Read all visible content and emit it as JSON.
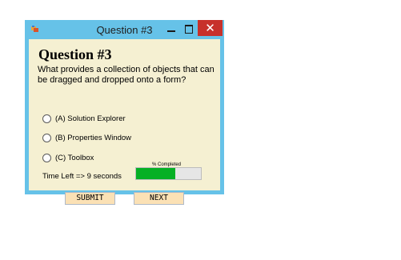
{
  "window": {
    "title": "Question #3"
  },
  "titlebar": {
    "minimize_icon": "minimize-icon",
    "maximize_icon": "maximize-icon",
    "close_glyph": "✕"
  },
  "question": {
    "heading": "Question #3",
    "text": "What provides a collection of objects that can be dragged and dropped onto a form?",
    "options": [
      {
        "label": "(A) Solution Explorer"
      },
      {
        "label": "(B) Properties Window"
      },
      {
        "label": "(C) Toolbox"
      }
    ]
  },
  "timer": {
    "text": "Time Left => 9 seconds"
  },
  "progress": {
    "label": "% Completed",
    "fraction": 0.6
  },
  "buttons": {
    "submit": "SUBMIT",
    "next": "NEXT"
  },
  "colors": {
    "frame": "#66c2e8",
    "client": "#f5f0d2",
    "close": "#c7312b",
    "progress_fill": "#06b025",
    "button": "#fbe1b5"
  }
}
